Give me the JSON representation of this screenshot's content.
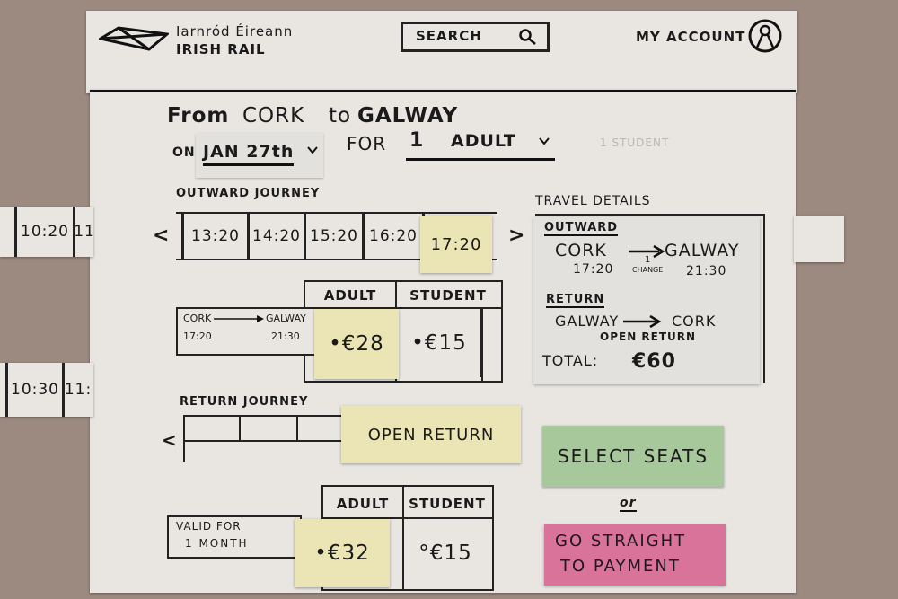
{
  "header": {
    "brand_line1": "Iarnród Éireann",
    "brand_line2": "IRISH RAIL",
    "search_label": "SEARCH",
    "account_label": "MY ACCOUNT"
  },
  "query": {
    "from_label": "From",
    "from_value": "CORK",
    "to_label": "to",
    "to_value": "GALWAY",
    "on_label": "ON",
    "date_value": "JAN 27th",
    "for_label": "FOR",
    "count_value": "1",
    "passenger_value": "ADULT",
    "ghost_text": "1 STUDENT"
  },
  "outward": {
    "heading": "OUTWARD JOURNEY",
    "times": [
      "13:20",
      "14:20",
      "15:20",
      "16:20",
      "17:20"
    ],
    "selected_time": "17:20",
    "loose_times_top": [
      "10:20",
      "11"
    ],
    "loose_times_bottom": [
      "10:30",
      "11:"
    ],
    "prev_arrow": "<",
    "next_arrow": ">",
    "fare_headers": [
      "ADULT",
      "STUDENT"
    ],
    "route_from": "CORK",
    "route_to": "GALWAY",
    "dep_time": "17:20",
    "arr_time": "21:30",
    "adult_price": "•€28",
    "student_price": "•€15"
  },
  "return": {
    "heading": "RETURN JOURNEY",
    "prev_arrow": "<",
    "open_return_label": "OPEN RETURN",
    "fare_headers": [
      "ADULT",
      "STUDENT"
    ],
    "valid_line1": "VALID FOR",
    "valid_line2": "1 MONTH",
    "adult_price": "•€32",
    "student_price": "°€15"
  },
  "travel_details": {
    "heading": "TRAVEL DETAILS",
    "outward_label": "OUTWARD",
    "out_from": "CORK",
    "out_to": "GALWAY",
    "out_dep": "17:20",
    "out_arr": "21:30",
    "change_count": "1",
    "change_label": "CHANGE",
    "return_label": "RETURN",
    "ret_from": "GALWAY",
    "ret_to": "CORK",
    "ret_type": "OPEN RETURN",
    "total_label": "TOTAL:",
    "total_value": "€60"
  },
  "actions": {
    "select_seats_label": "SELECT SEATS",
    "or_label": "or",
    "payment_line1": "GO STRAIGHT",
    "payment_line2": "TO PAYMENT"
  },
  "colors": {
    "background": "#9c8a80",
    "paper": "#e9e6e2",
    "sticky_yellow": "#ebe4b5",
    "sticky_green": "#a6c89a",
    "sticky_pink": "#d9739a",
    "ink": "#1a1a1a"
  }
}
